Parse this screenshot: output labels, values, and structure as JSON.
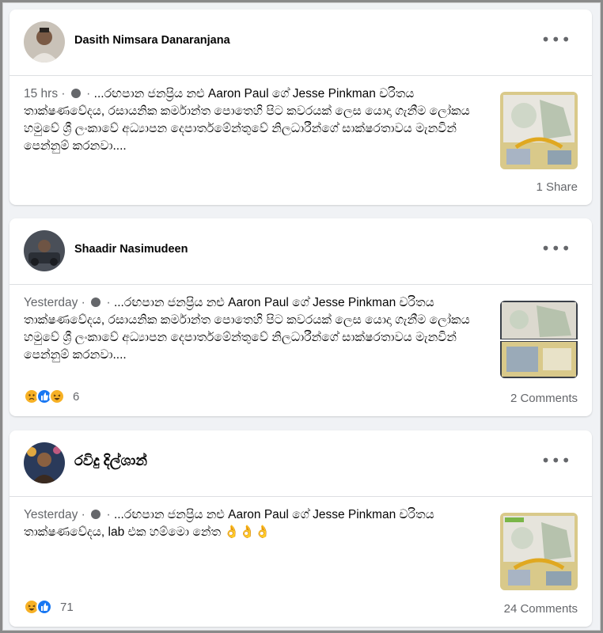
{
  "posts": [
    {
      "author": "Dasith Nimsara Danaranjana",
      "time": "15 hrs",
      "text": "...රඟපාන ජනප්‍රිය නළු Aaron Paul ගේ Jesse Pinkman චරිතය තාක්ෂණවේදය, රසායනික කර්මාන්ත පොතෙහි පිට කවරයක් ලෙස යොදා ගැනීම ලෝකය හමුවේ ශ්‍රී ලංකාවේ අධ්‍යාපන දෙපාර්තමේන්තුවේ නිලධාරීන්ගේ සාක්ෂරතාවය මැනවින් පෙන්නුම් කරනවා....",
      "footer": "1 Share"
    },
    {
      "author": "Shaadir Nasimudeen",
      "time": "Yesterday",
      "text": "...රඟපාන ජනප්‍රිය නළු Aaron Paul ගේ Jesse Pinkman චරිතය තාක්ෂණවේදය, රසායනික කර්මාන්ත පොතෙහි පිට කවරයක් ලෙස යොදා ගැනීම ලෝකය හමුවේ ශ්‍රී ලංකාවේ අධ්‍යාපන දෙපාර්තමේන්තුවේ නිලධාරීන්ගේ සාක්ෂරතාවය මැනවින් පෙන්නුම් කරනවා....",
      "reaction_count": "6",
      "footer": "2 Comments"
    },
    {
      "author": "රවිදු දිල්ශාන්",
      "time": "Yesterday",
      "text": "...රඟපාන ජනප්‍රිය නළු Aaron Paul ගේ Jesse Pinkman චරිතය තාක්ෂණවේදය, lab එක හම්මො නේත 👌👌👌",
      "reaction_count": "71",
      "footer": "24 Comments"
    }
  ],
  "separator": " · ",
  "more_label": "•••",
  "icons": {
    "globe": "globe-icon",
    "more": "more-options-icon",
    "sad": "sad-reaction-icon",
    "like": "like-reaction-icon",
    "haha": "haha-reaction-icon"
  }
}
